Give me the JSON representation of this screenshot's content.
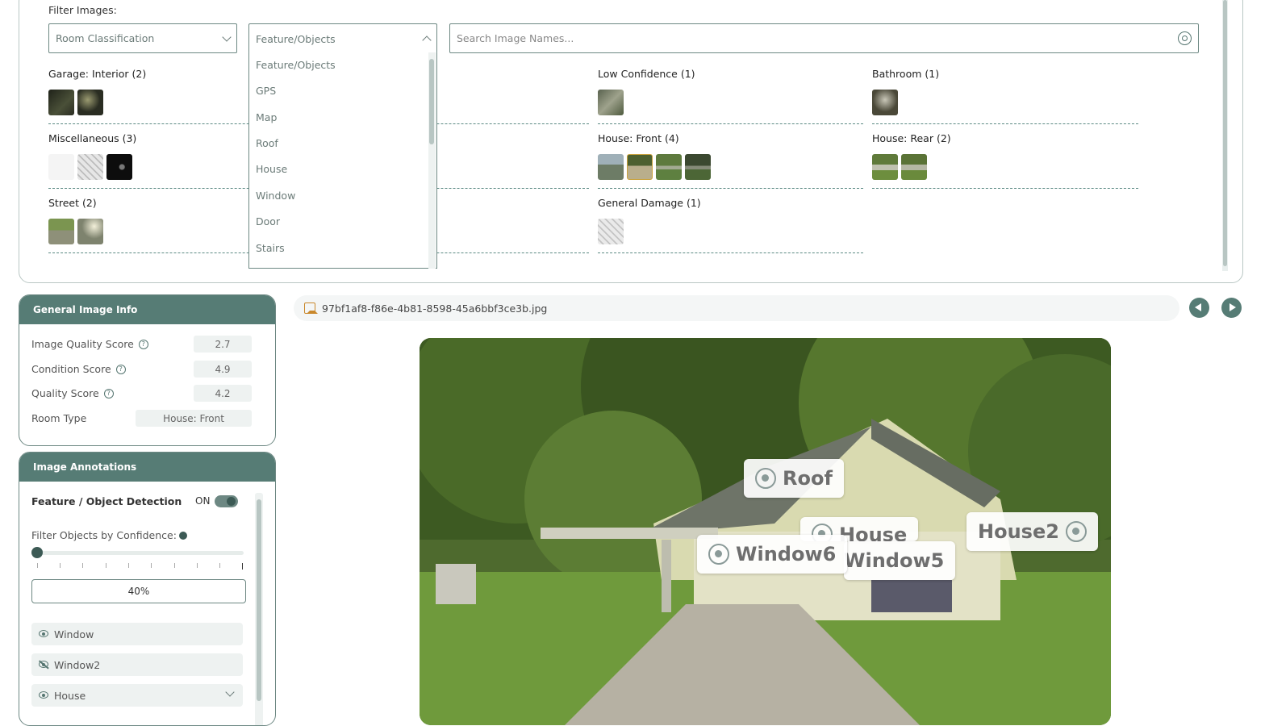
{
  "filter": {
    "title": "Filter Images:",
    "room_select": "Room Classification",
    "feature_select": "Feature/Objects",
    "search_placeholder": "Search Image Names...",
    "dropdown_options": [
      "Feature/Objects",
      "GPS",
      "Map",
      "Roof",
      "House",
      "Window",
      "Door",
      "Stairs"
    ]
  },
  "groups": [
    {
      "title": "Garage: Interior (2)",
      "count": 2,
      "colors": [
        "#2e3026",
        "#3b4030"
      ]
    },
    {
      "title": "Low Confidence (1)",
      "count": 1,
      "colors": [
        "#6f7a62"
      ]
    },
    {
      "title": "Bathroom (1)",
      "count": 1,
      "colors": [
        "#5a5646"
      ]
    },
    {
      "title": "Miscellaneous (3)",
      "count": 3,
      "colors": [
        "#f2f2f2",
        "#d8d8d8",
        "#111111"
      ]
    },
    {
      "title": "House: Front (4)",
      "count": 4,
      "colors": [
        "#7f8a88",
        "#8b9a5a",
        "#6d8a52",
        "#4d5a44"
      ]
    },
    {
      "title": "House: Rear (2)",
      "count": 2,
      "colors": [
        "#7e9258",
        "#7a8c55"
      ]
    },
    {
      "title": "Street (2)",
      "count": 2,
      "colors": [
        "#6d7d4a",
        "#8a8f7e"
      ]
    },
    {
      "title": "General Damage (1)",
      "count": 1,
      "colors": [
        "#dcdcdc"
      ]
    }
  ],
  "general_info": {
    "title": "General Image Info",
    "rows": [
      {
        "label": "Image Quality Score",
        "value": "2.7",
        "help": "?"
      },
      {
        "label": "Condition Score",
        "value": "4.9",
        "help": "?"
      },
      {
        "label": "Quality Score",
        "value": "4.2",
        "help": "?"
      },
      {
        "label": "Room Type",
        "value": "House: Front"
      }
    ]
  },
  "annotations": {
    "title": "Image Annotations",
    "detection_label": "Feature / Object Detection",
    "toggle_state": "ON",
    "confidence_label": "Filter Objects by Confidence:",
    "confidence_value": "40%",
    "confidence_fraction": 0.0,
    "objects": [
      {
        "label": "Window",
        "visible": true
      },
      {
        "label": "Window2",
        "visible": false
      },
      {
        "label": "House",
        "visible": true,
        "expandable": true
      }
    ]
  },
  "file": {
    "name": "97bf1af8-f86e-4b81-8598-45a6bbf3ce3b.jpg"
  },
  "image_labels": [
    "Roof",
    "House",
    "Window6",
    "Window5",
    "House2"
  ],
  "colors": {
    "accent": "#567c75",
    "border": "#6d8883"
  }
}
